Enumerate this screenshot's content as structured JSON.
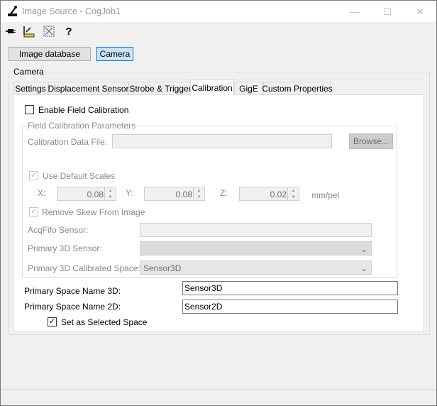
{
  "window": {
    "title": "Image Source - CogJob1",
    "minimize_glyph": "—",
    "maximize_glyph": "☐",
    "close_glyph": "✕"
  },
  "toolbar": {
    "icons": [
      "connector-icon",
      "ruler-icon",
      "grid-icon",
      "help-icon"
    ],
    "help_glyph": "?"
  },
  "source_buttons": {
    "image_database": "Image database",
    "camera": "Camera"
  },
  "camera_group": {
    "label": "Camera"
  },
  "tabs": [
    {
      "label": "Settings"
    },
    {
      "label": "Displacement Sensor"
    },
    {
      "label": "Strobe & Trigger"
    },
    {
      "label": "Calibration"
    },
    {
      "label": "GigE"
    },
    {
      "label": "Custom Properties"
    }
  ],
  "calibration": {
    "enable_field_calibration": {
      "label": "Enable Field Calibration",
      "checked": false
    },
    "params_group_label": "Field Calibration Parameters",
    "data_file": {
      "label": "Calibration Data File:",
      "value": "",
      "browse_label": "Browse..."
    },
    "use_default_scales": {
      "label": "Use Default Scales",
      "checked": true
    },
    "scales": {
      "x_label": "X:",
      "x_value": "0.08",
      "y_label": "Y:",
      "y_value": "0.08",
      "z_label": "Z:",
      "z_value": "0.02",
      "unit": "mm/pel"
    },
    "remove_skew": {
      "label": "Remove Skew From Image",
      "checked": true
    },
    "acqfifo_sensor": {
      "label": "AcqFifo Sensor:",
      "value": ""
    },
    "primary_3d_sensor": {
      "label": "Primary 3D Sensor:",
      "value": ""
    },
    "primary_3d_calibrated_space": {
      "label": "Primary 3D Calibrated Space:",
      "value": "Sensor3D"
    }
  },
  "space_names": {
    "name_3d": {
      "label": "Primary Space Name 3D:",
      "value": "Sensor3D"
    },
    "name_2d": {
      "label": "Primary Space Name 2D:",
      "value": "Sensor2D"
    },
    "set_selected": {
      "label": "Set as Selected Space",
      "checked": true
    }
  },
  "glyphs": {
    "check": "✓",
    "spin_up": "▲",
    "spin_down": "▼",
    "dropdown": "⌄"
  }
}
